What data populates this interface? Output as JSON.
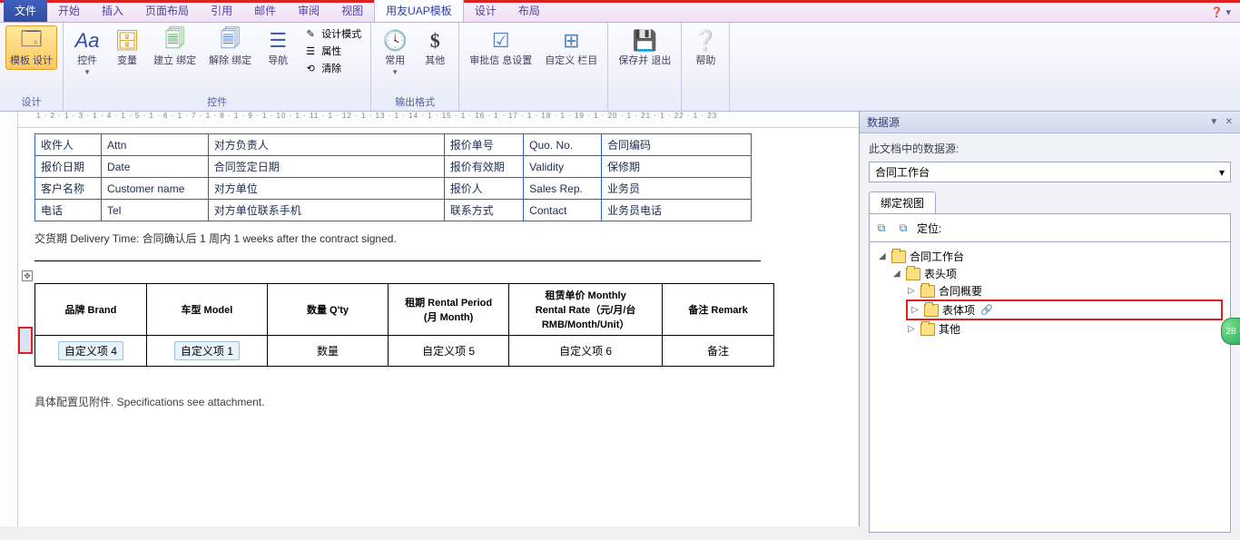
{
  "menubar": {
    "file": "文件",
    "tabs": [
      "开始",
      "插入",
      "页面布局",
      "引用",
      "邮件",
      "审阅",
      "视图",
      "用友UAP模板",
      "设计",
      "布局"
    ],
    "activeIndex": 7
  },
  "ribbon": {
    "groups": {
      "design": {
        "label": "设计",
        "template": "模板\n设计"
      },
      "controls": {
        "label": "控件",
        "font": "Aa",
        "font_label": "控件",
        "var": "变量",
        "bind_create": "建立\n绑定",
        "bind_remove": "解除\n绑定",
        "nav": "导航",
        "col": {
          "design_mode": "设计模式",
          "property": "属性",
          "clear": "清除"
        }
      },
      "format": {
        "label": "输出格式",
        "common": "常用",
        "other": "其他",
        "icon_text": "$"
      },
      "lookup": {
        "approve": "审批信\n息设置",
        "custom": "自定义\n栏目",
        "save_exit": "保存并\n退出",
        "help": "帮助"
      }
    }
  },
  "hruler_text": "1 · 2 · 1 · 3 · 1 · 4 · 1 · 5 · 1 · 6 · 1 · 7 · 1 · 8 · 1 · 9 · 1 · 10 · 1 · 11 · 1 · 12 · 1 · 13 · 1 · 14 · 1 · 15 · 1 · 16 · 1 · 17 · 1 · 18 · 1 · 19 · 1 · 20 · 1 · 21 · 1 · 22 · 1 · 23",
  "info_table": {
    "r1": {
      "a": "收件人",
      "b": "Attn",
      "c": "对方负责人",
      "d": "报价单号",
      "e": "Quo. No.",
      "f": "合同编码"
    },
    "r2": {
      "a": "报价日期",
      "b": "Date",
      "c": "合同签定日期",
      "d": "报价有效期",
      "e": "Validity",
      "f": "保修期"
    },
    "r3": {
      "a": "客户名称",
      "b": "Customer name",
      "c": "对方单位",
      "d": "报价人",
      "e": "Sales Rep.",
      "f": "业务员"
    },
    "r4": {
      "a": "电话",
      "b": "Tel",
      "c": "对方单位联系手机",
      "d": "联系方式",
      "e": "Contact",
      "f": "业务员电话"
    }
  },
  "delivery_text": "交货期 Delivery Time: 合同确认后  1  周内     1     weeks after the contract signed.",
  "detail_table": {
    "headers": [
      "品牌 Brand",
      "车型 Model",
      "数量 Q'ty",
      "租期 Rental Period\n(月 Month)",
      "租赁单价 Monthly\nRental Rate（元/月/台\nRMB/Month/Unit）",
      "备注 Remark"
    ],
    "row": [
      "自定义项 4",
      "自定义项 1",
      "数量",
      "自定义项 5",
      "自定义项 6",
      "备注"
    ]
  },
  "footer_text": "具体配置见附件. Specifications see attachment.",
  "datapane": {
    "title": "数据源",
    "label": "此文档中的数据源:",
    "select": "合同工作台",
    "tab": "绑定视图",
    "locate": "定位:",
    "tree": {
      "root": "合同工作台",
      "header": "表头项",
      "body": "表体项",
      "other": "其他",
      "summary": "合同概要"
    }
  },
  "edge_badge": "28"
}
